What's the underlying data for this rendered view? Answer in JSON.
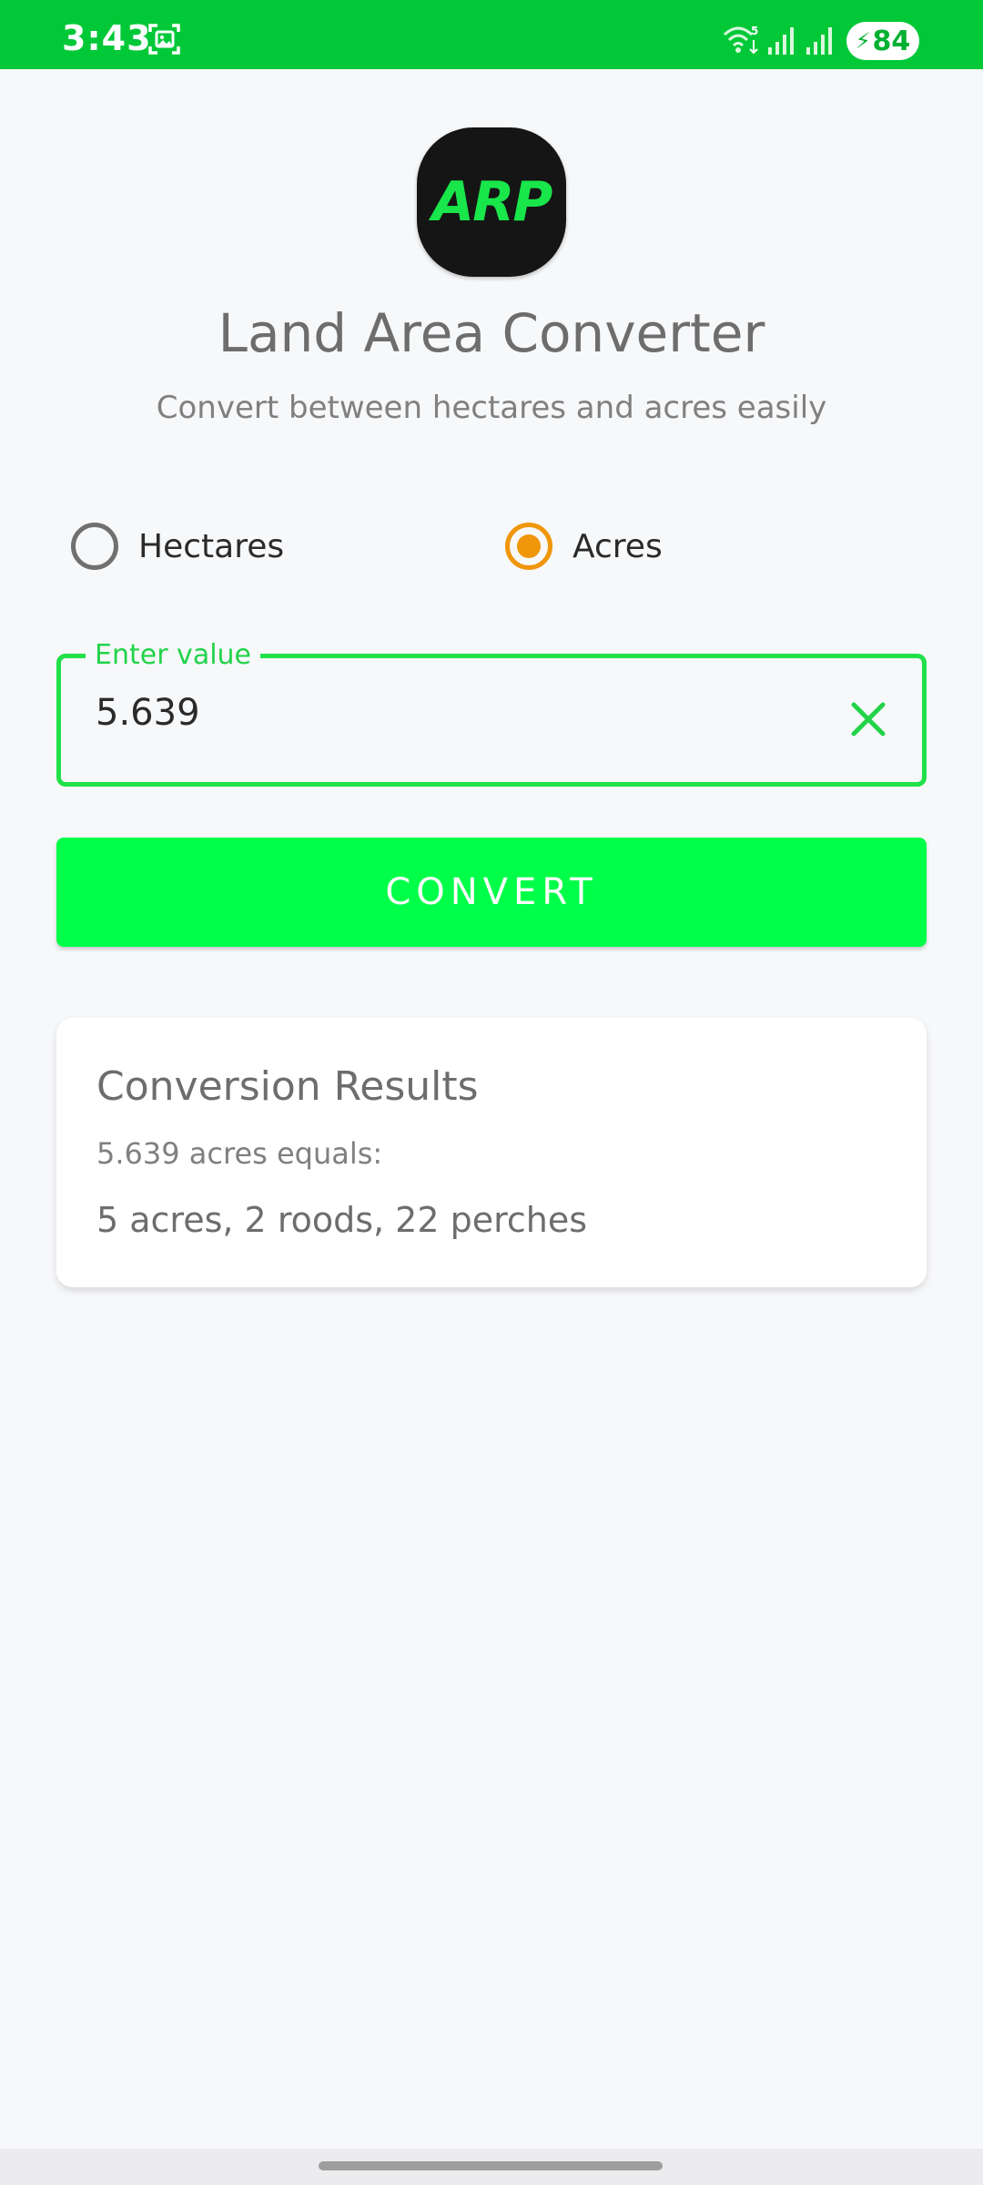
{
  "status_bar": {
    "time": "3:43",
    "battery": "84",
    "icons": [
      "screenshot-icon",
      "wifi-icon",
      "signal-icon",
      "signal-icon",
      "battery-charging-icon"
    ],
    "background_color": "#00c837"
  },
  "app": {
    "logo_text": "ARP",
    "title": "Land Area Converter",
    "subtitle": "Convert between hectares and acres easily"
  },
  "unit_selector": {
    "options": [
      {
        "label": "Hectares",
        "selected": false
      },
      {
        "label": "Acres",
        "selected": true
      }
    ],
    "selected_color": "#f0960a"
  },
  "input": {
    "label": "Enter value",
    "value": "5.639",
    "accent_color": "#22e04a"
  },
  "convert_button": {
    "label": "CONVERT",
    "color": "#00ff48"
  },
  "results": {
    "title": "Conversion Results",
    "subtitle": "5.639 acres equals:",
    "value": "5 acres, 2 roods, 22 perches"
  }
}
